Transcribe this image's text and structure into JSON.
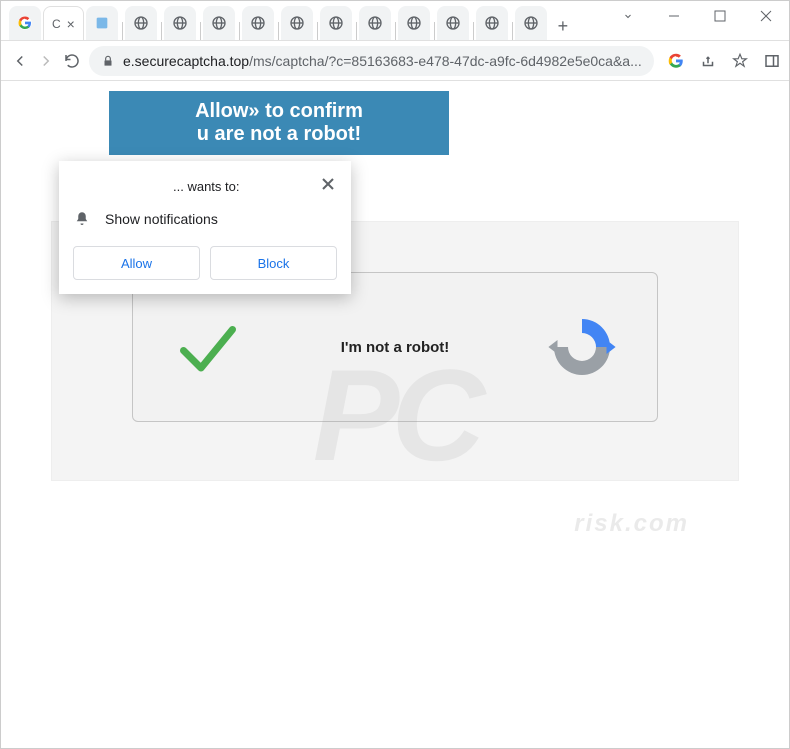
{
  "window": {
    "minimize": "—",
    "maximize": "☐",
    "close": "✕"
  },
  "tabs": {
    "active_title": "C",
    "new_tab": "+"
  },
  "toolbar": {
    "url_domain": "e.securecaptcha.top",
    "url_path": "/ms/captcha/?c=85163683-e478-47dc-a9fc-6d4982e5e0ca&a..."
  },
  "banner": {
    "line1": "Allow» to confirm",
    "line2": "u are not a robot!"
  },
  "captcha": {
    "text": "I'm not a robot!"
  },
  "popup": {
    "title": "... wants to:",
    "permission": "Show notifications",
    "allow": "Allow",
    "block": "Block"
  },
  "watermark": {
    "main": "PC",
    "sub": "risk.com"
  }
}
